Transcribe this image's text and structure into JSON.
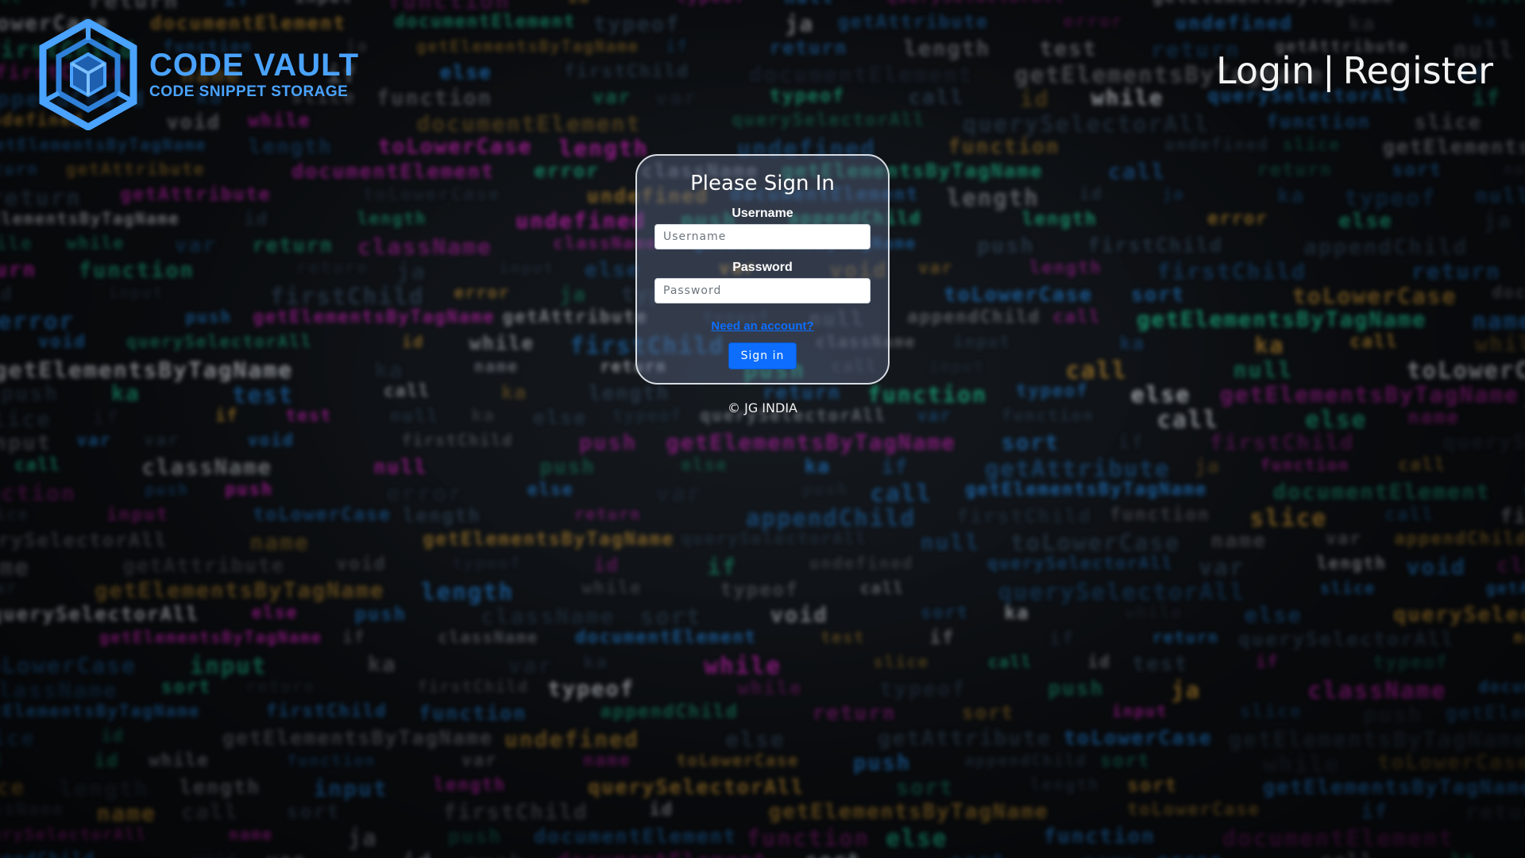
{
  "brand": {
    "title": "CODE VAULT",
    "subtitle": "CODE SNIPPET STORAGE",
    "logo_icon": "hexagon-cube-logo-icon",
    "accent_color": "#4aa3ff"
  },
  "nav": {
    "login": "Login",
    "separator": "|",
    "register": "Register"
  },
  "signin": {
    "title": "Please Sign In",
    "username_label": "Username",
    "username_placeholder": "Username",
    "username_value": "",
    "password_label": "Password",
    "password_placeholder": "Password",
    "password_value": "",
    "account_link": "Need an account?",
    "submit_label": "Sign in",
    "button_color": "#0d6efd"
  },
  "footer": {
    "text": "© JG INDIA"
  }
}
